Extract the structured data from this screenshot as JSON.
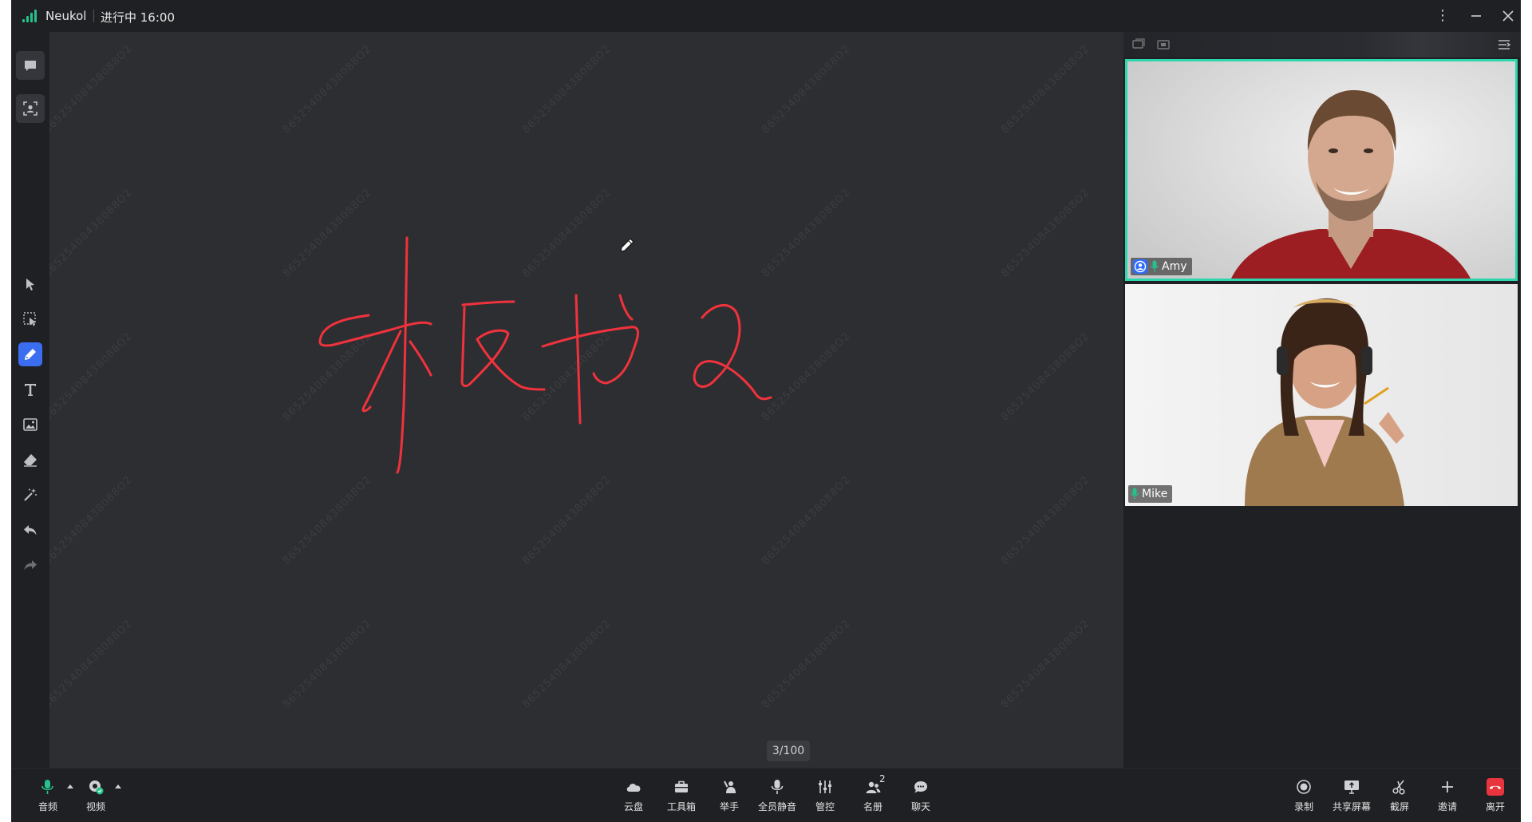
{
  "titlebar": {
    "app_name": "Neukol",
    "status": "进行中 16:00",
    "more_icon": "more-vertical-icon",
    "minimize_icon": "minimize-icon",
    "close_icon": "close-icon"
  },
  "left_tools": [
    {
      "id": "chat-panel",
      "icon": "comment-icon"
    },
    {
      "id": "face-scan",
      "icon": "face-scan-icon"
    },
    {
      "id": "select",
      "icon": "cursor-arrow-icon"
    },
    {
      "id": "area-select",
      "icon": "area-select-icon"
    },
    {
      "id": "pen",
      "icon": "pen-icon",
      "active": true
    },
    {
      "id": "text",
      "icon": "text-icon"
    },
    {
      "id": "image",
      "icon": "image-icon"
    },
    {
      "id": "eraser",
      "icon": "eraser-icon"
    },
    {
      "id": "magic",
      "icon": "magic-wand-icon"
    },
    {
      "id": "undo",
      "icon": "undo-icon"
    },
    {
      "id": "redo",
      "icon": "redo-icon"
    }
  ],
  "board": {
    "watermark": "86525408438088O2",
    "page_indicator": "3/100",
    "ink_color": "#f0323c"
  },
  "participants": [
    {
      "name": "Amy",
      "active_speaker": true,
      "host": true
    },
    {
      "name": "Mike",
      "active_speaker": false,
      "host": false
    }
  ],
  "bottom_left": {
    "audio_label": "音频",
    "video_label": "视频"
  },
  "bottom_center": {
    "cloud_label": "云盘",
    "toolbox_label": "工具箱",
    "raise_hand_label": "举手",
    "mute_all_label": "全员静音",
    "manage_label": "管控",
    "roster_label": "名册",
    "roster_count": "2",
    "chat_label": "聊天"
  },
  "bottom_right": {
    "record_label": "录制",
    "share_label": "共享屏幕",
    "screenshot_label": "截屏",
    "invite_label": "邀请",
    "leave_label": "离开"
  },
  "colors": {
    "accent_blue": "#3a6df0",
    "active_speaker_border": "#2ed6ad",
    "leave_red": "#e8353d",
    "mic_green": "#25c28b"
  }
}
